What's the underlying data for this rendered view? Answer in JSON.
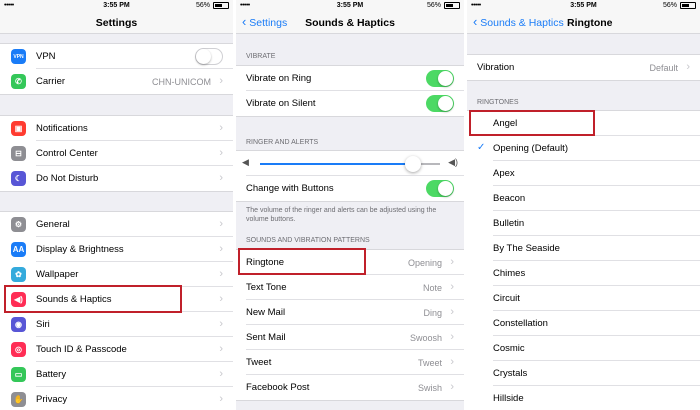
{
  "status": {
    "signal": "•••••",
    "time": "3:55 PM",
    "battery_pct": "56%",
    "battery_level": 0.56
  },
  "settings": {
    "title": "Settings",
    "group1": [
      {
        "label": "VPN",
        "icon": "vpn-icon",
        "color": "#1a7cf7",
        "glyph": "VPN",
        "toggle": false
      },
      {
        "label": "Carrier",
        "icon": "carrier-icon",
        "color": "#34c759",
        "glyph": "✆",
        "value": "CHN-UNICOM"
      }
    ],
    "group2": [
      {
        "label": "Notifications",
        "icon": "notifications-icon",
        "color": "#ff3b30",
        "glyph": "▣"
      },
      {
        "label": "Control Center",
        "icon": "control-center-icon",
        "color": "#8e8e93",
        "glyph": "⊟"
      },
      {
        "label": "Do Not Disturb",
        "icon": "moon-icon",
        "color": "#5856d6",
        "glyph": "☾"
      }
    ],
    "group3": [
      {
        "label": "General",
        "icon": "gear-icon",
        "color": "#8e8e93",
        "glyph": "⚙"
      },
      {
        "label": "Display & Brightness",
        "icon": "display-icon",
        "color": "#1a7cf7",
        "glyph": "AA"
      },
      {
        "label": "Wallpaper",
        "icon": "wallpaper-icon",
        "color": "#34aadc",
        "glyph": "✿"
      },
      {
        "label": "Sounds & Haptics",
        "icon": "speaker-icon",
        "color": "#ff2d55",
        "glyph": "◀)"
      },
      {
        "label": "Siri",
        "icon": "siri-icon",
        "color": "#5856d6",
        "glyph": "◉"
      },
      {
        "label": "Touch ID & Passcode",
        "icon": "fingerprint-icon",
        "color": "#ff2d55",
        "glyph": "◎"
      },
      {
        "label": "Battery",
        "icon": "battery-icon",
        "color": "#34c759",
        "glyph": "▭"
      },
      {
        "label": "Privacy",
        "icon": "hand-icon",
        "color": "#8e8e93",
        "glyph": "✋"
      }
    ]
  },
  "sounds": {
    "back": "Settings",
    "title": "Sounds & Haptics",
    "vibrate_header": "VIBRATE",
    "vibrate": [
      {
        "label": "Vibrate on Ring",
        "toggle": true
      },
      {
        "label": "Vibrate on Silent",
        "toggle": true
      }
    ],
    "ringer_header": "RINGER AND ALERTS",
    "volume_level": 0.85,
    "change_with_buttons": "Change with Buttons",
    "ringer_note": "The volume of the ringer and alerts can be adjusted using the volume buttons.",
    "patterns_header": "SOUNDS AND VIBRATION PATTERNS",
    "patterns": [
      {
        "label": "Ringtone",
        "value": "Opening"
      },
      {
        "label": "Text Tone",
        "value": "Note"
      },
      {
        "label": "New Mail",
        "value": "Ding"
      },
      {
        "label": "Sent Mail",
        "value": "Swoosh"
      },
      {
        "label": "Tweet",
        "value": "Tweet"
      },
      {
        "label": "Facebook Post",
        "value": "Swish"
      }
    ]
  },
  "ringtone": {
    "back": "Sounds & Haptics",
    "title": "Ringtone",
    "vibration_label": "Vibration",
    "vibration_value": "Default",
    "ringtones_header": "RINGTONES",
    "items": [
      "Angel",
      "Opening (Default)",
      "Apex",
      "Beacon",
      "Bulletin",
      "By The Seaside",
      "Chimes",
      "Circuit",
      "Constellation",
      "Cosmic",
      "Crystals",
      "Hillside"
    ],
    "selected": 1
  },
  "colors": {
    "accent": "#1a7cf7",
    "toggle_on": "#4cd964",
    "highlight": "#c0202a"
  }
}
